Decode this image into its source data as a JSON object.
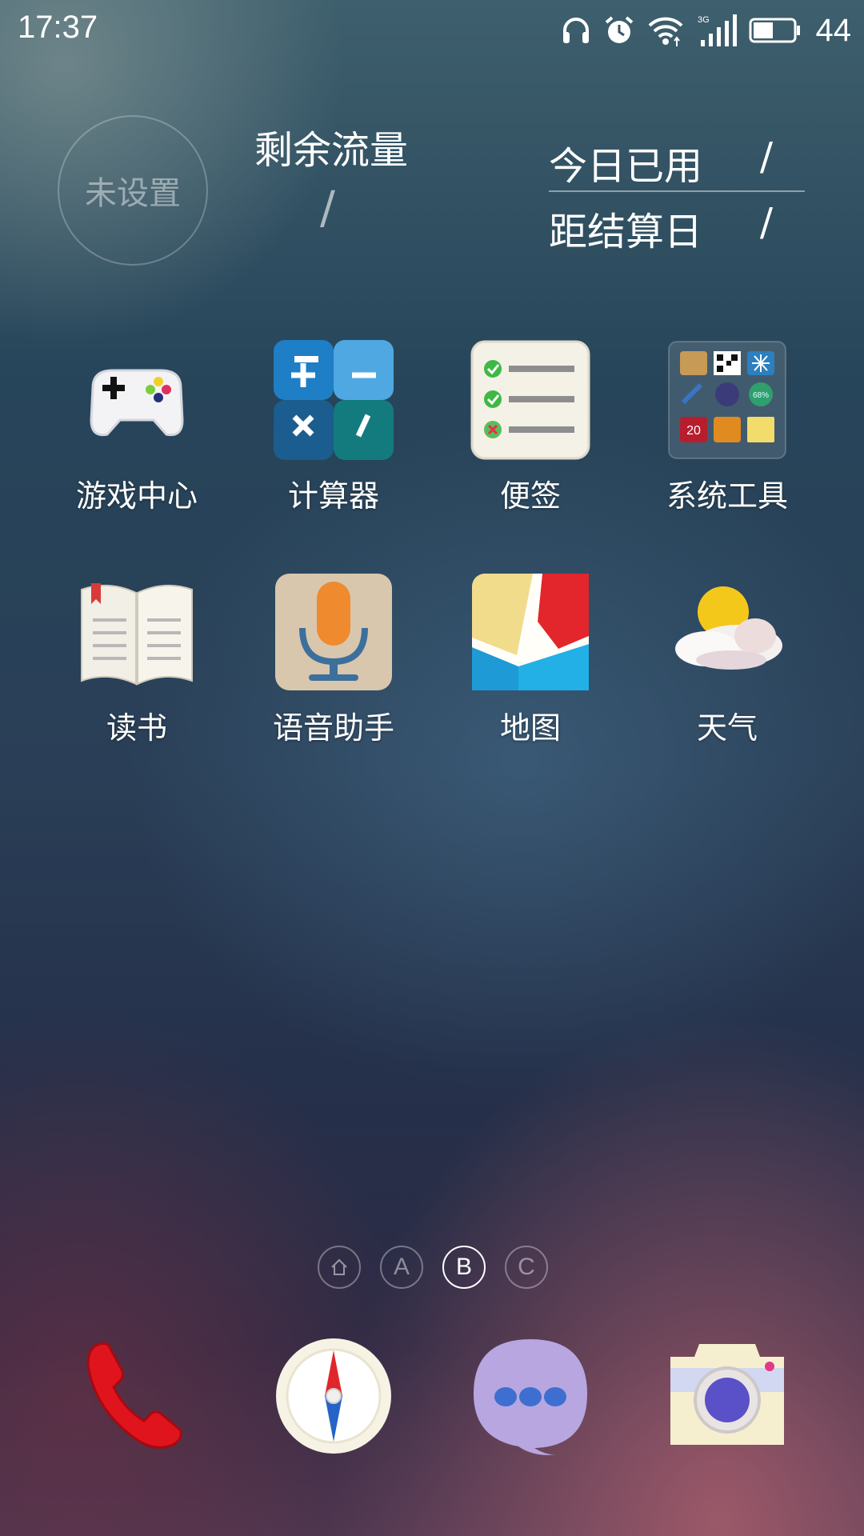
{
  "status_bar": {
    "time": "17:37",
    "network_type": "3G",
    "battery_level": "44",
    "icons": [
      "headphones-icon",
      "alarm-icon",
      "wifi-icon",
      "signal-icon",
      "battery-icon"
    ]
  },
  "data_widget": {
    "circle_label": "未设置",
    "remaining_title": "剩余流量",
    "remaining_value": "/",
    "today_used_label": "今日已用",
    "today_used_value": "/",
    "days_to_billing_label": "距结算日",
    "days_to_billing_value": "/"
  },
  "apps": [
    {
      "label": "游戏中心",
      "icon": "gamepad-icon"
    },
    {
      "label": "计算器",
      "icon": "calculator-icon"
    },
    {
      "label": "便签",
      "icon": "notes-icon"
    },
    {
      "label": "系统工具",
      "icon": "folder-icon"
    },
    {
      "label": "读书",
      "icon": "book-icon"
    },
    {
      "label": "语音助手",
      "icon": "microphone-icon"
    },
    {
      "label": "地图",
      "icon": "map-icon"
    },
    {
      "label": "天气",
      "icon": "weather-icon"
    }
  ],
  "folder_badge": "20",
  "folder_percent": "68%",
  "pager": {
    "pages": [
      "⌂",
      "A",
      "B",
      "C"
    ],
    "active_index": 2
  },
  "dock": [
    {
      "icon": "phone-icon"
    },
    {
      "icon": "compass-icon"
    },
    {
      "icon": "messages-icon"
    },
    {
      "icon": "camera-icon"
    }
  ]
}
